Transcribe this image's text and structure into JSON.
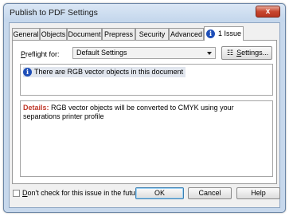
{
  "window": {
    "title": "Publish to PDF Settings",
    "close_label": "x"
  },
  "tabs": [
    {
      "label": "General"
    },
    {
      "label": "Objects"
    },
    {
      "label": "Document"
    },
    {
      "label": "Prepress"
    },
    {
      "label": "Security"
    },
    {
      "label": "Advanced"
    },
    {
      "label": "1 Issue",
      "icon": "info-icon",
      "active": true
    }
  ],
  "preflight": {
    "label_prefix": "P",
    "label_rest": "reflight for:",
    "selected": "Default Settings",
    "settings_prefix": "S",
    "settings_rest": "ettings..."
  },
  "issues": [
    {
      "icon": "info-icon",
      "text": "There are RGB vector objects in this document"
    }
  ],
  "details": {
    "heading": "Details:",
    "text": " RGB vector objects will be converted to CMYK using your separations printer profile"
  },
  "checkbox": {
    "label_prefix": "D",
    "label_rest": "on't check for this issue in the future",
    "checked": false
  },
  "buttons": {
    "ok": "OK",
    "cancel": "Cancel",
    "help": "Help"
  },
  "colors": {
    "titlebar": "#c7d8ec",
    "info_icon": "#1f4fb8",
    "details_heading": "#c0392b",
    "close_button": "#c7462f"
  }
}
